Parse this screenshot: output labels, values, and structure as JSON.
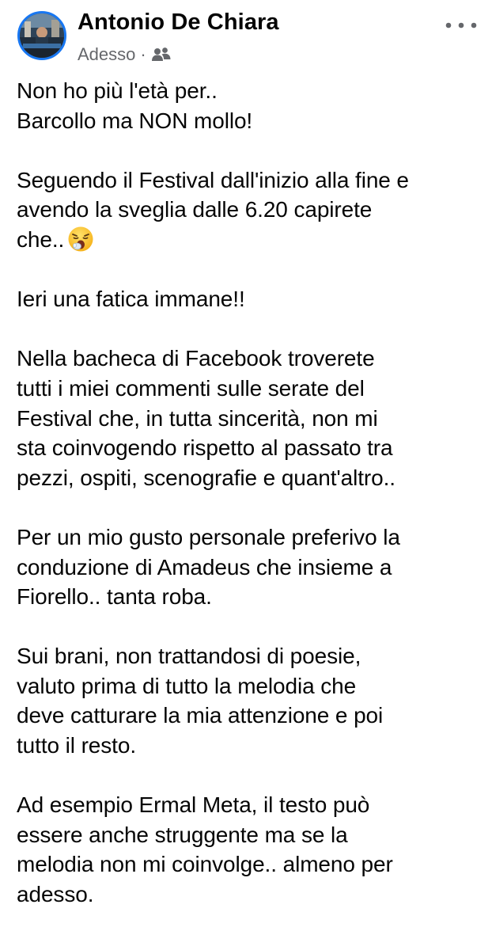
{
  "post": {
    "author": "Antonio De Chiara",
    "timestamp": "Adesso",
    "separator": "·",
    "audience_icon": "friends-icon",
    "more_icon": "more-horizontal-icon",
    "accent_color": "#1877f2",
    "paragraphs": [
      [
        "Non ho più l'età per..",
        "Barcollo ma NON mollo!"
      ],
      [
        "Seguendo il Festival dall'inizio alla fine e",
        "avendo la sveglia dalle 6.20 capirete",
        "che.."
      ],
      [
        "Ieri una fatica immane!!"
      ],
      [
        "Nella bacheca di Facebook troverete",
        "tutti i miei commenti sulle serate del",
        "Festival che, in tutta sincerità, non mi",
        "sta coinvogendo rispetto al passato tra",
        "pezzi, ospiti, scenografie e quant'altro.."
      ],
      [
        "Per un mio gusto personale preferivo la",
        "conduzione di Amadeus che insieme a",
        "Fiorello.. tanta roba."
      ],
      [
        "Sui brani, non trattandosi di poesie,",
        "valuto prima di tutto la melodia che",
        "deve catturare la mia attenzione e poi",
        "tutto il resto."
      ],
      [
        "Ad esempio Ermal Meta, il testo può",
        "essere anche struggente ma se la",
        "melodia non mi coinvolge.. almeno per",
        "adesso."
      ]
    ],
    "emoji": "yawning-face-emoji"
  }
}
